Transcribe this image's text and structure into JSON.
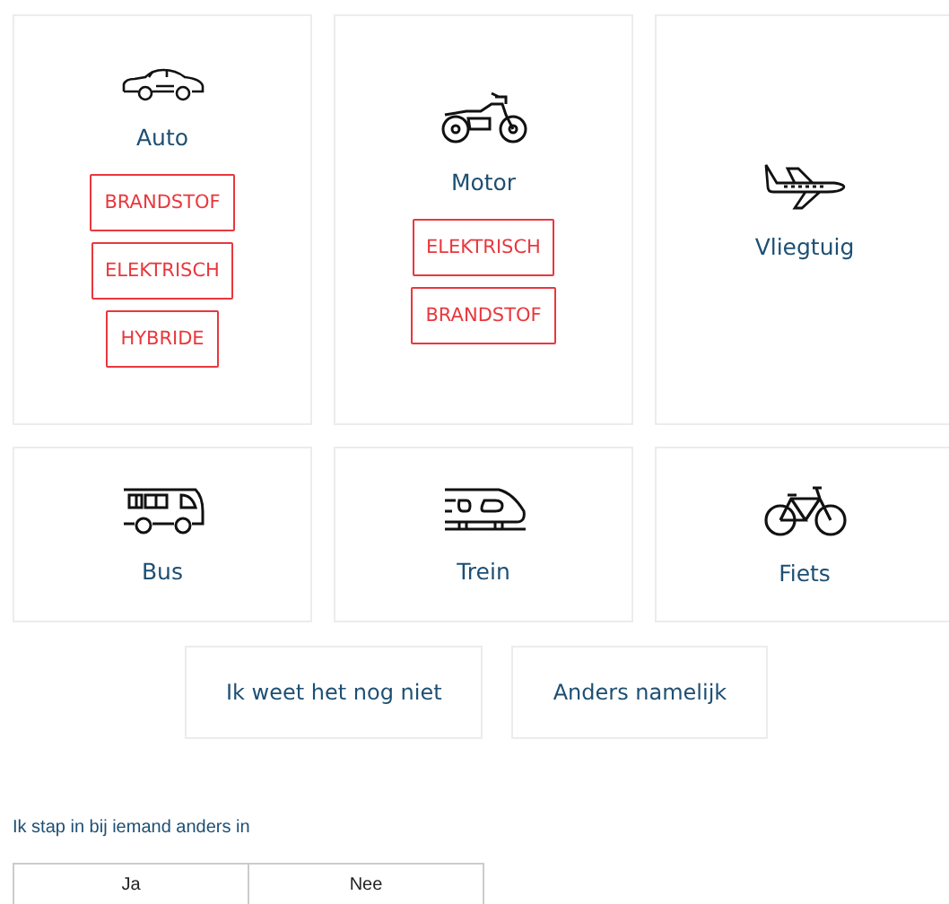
{
  "vehicles": [
    {
      "label": "Auto",
      "options": [
        "BRANDSTOF",
        "ELEKTRISCH",
        "HYBRIDE"
      ]
    },
    {
      "label": "Motor",
      "options": [
        "ELEKTRISCH",
        "BRANDSTOF"
      ]
    },
    {
      "label": "Vliegtuig"
    },
    {
      "label": "Bus"
    },
    {
      "label": "Trein"
    },
    {
      "label": "Fiets"
    }
  ],
  "other_choices": [
    "Ik weet het nog niet",
    "Anders namelijk"
  ],
  "question": {
    "text": "Ik stap in bij iemand anders in",
    "answers": [
      "Ja",
      "Nee"
    ]
  }
}
